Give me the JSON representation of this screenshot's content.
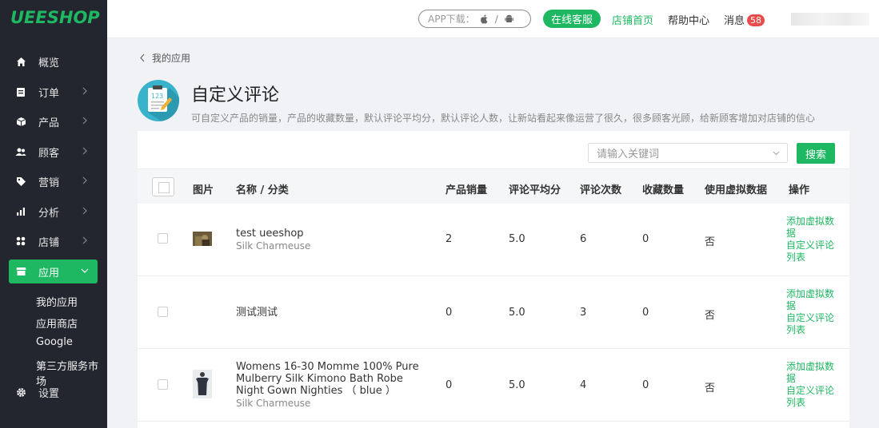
{
  "logo": "UEESHOP",
  "sidebar": {
    "items": [
      {
        "label": "概览",
        "icon": "home-icon"
      },
      {
        "label": "订单",
        "icon": "order-icon"
      },
      {
        "label": "产品",
        "icon": "box-icon"
      },
      {
        "label": "顾客",
        "icon": "users-icon"
      },
      {
        "label": "营销",
        "icon": "tag-icon"
      },
      {
        "label": "分析",
        "icon": "bar-chart-icon"
      },
      {
        "label": "店铺",
        "icon": "grid-icon"
      },
      {
        "label": "应用",
        "icon": "store-icon"
      },
      {
        "label": "设置",
        "icon": "gear-icon"
      }
    ],
    "subitems": [
      "我的应用",
      "应用商店",
      "Google",
      "第三方服务市场"
    ]
  },
  "header": {
    "app_download": "APP下载：",
    "service": "在线客服",
    "store_home": "店铺首页",
    "help": "帮助中心",
    "messages": "消息",
    "message_count": "58"
  },
  "breadcrumb": "我的应用",
  "page": {
    "title": "自定义评论",
    "desc": "可自定义产品的销量，产品的收藏数量，默认评论平均分，默认评论人数，让新站看起来像运营了很久，很多顾客光顾，给新顾客增加对店铺的信心"
  },
  "search": {
    "placeholder": "请输入关键词",
    "button": "搜索"
  },
  "table": {
    "headers": [
      "图片",
      "名称 / 分类",
      "产品销量",
      "评论平均分",
      "评论次数",
      "收藏数量",
      "使用虚拟数据",
      "操作"
    ],
    "rows": [
      {
        "name": "test ueeshop",
        "category": "Silk Charmeuse",
        "sales": "2",
        "avg": "5.0",
        "reviews": "6",
        "favorites": "0",
        "virtual": "否",
        "op1": "添加虚拟数据",
        "op2": "自定义评论列表"
      },
      {
        "name": "测试测试",
        "category": "",
        "sales": "0",
        "avg": "5.0",
        "reviews": "3",
        "favorites": "0",
        "virtual": "否",
        "op1": "添加虚拟数据",
        "op2": "自定义评论列表"
      },
      {
        "name": "Womens 16-30 Momme 100% Pure Mulberry Silk Kimono Bath Robe Night Gown Nighties （ blue ）",
        "category": "Silk Charmeuse",
        "sales": "0",
        "avg": "5.0",
        "reviews": "4",
        "favorites": "0",
        "virtual": "否",
        "op1": "添加虚拟数据",
        "op2": "自定义评论列表"
      }
    ]
  }
}
